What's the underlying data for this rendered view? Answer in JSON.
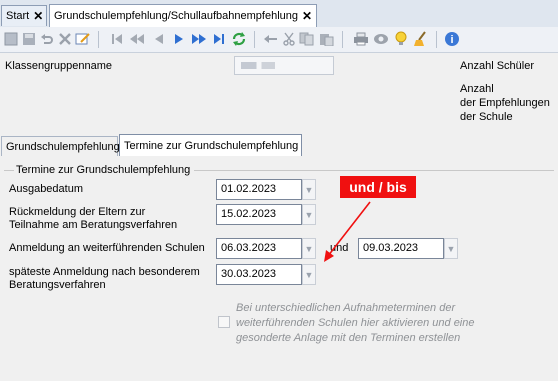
{
  "doc_tabs": [
    {
      "label": "Start",
      "close": "✕"
    },
    {
      "label": "Grundschulempfehlung/Schullaufbahnempfehlung",
      "close": "✕"
    }
  ],
  "toolbar": {
    "icons": [
      "new-icon",
      "save-icon",
      "undo-icon",
      "delete-icon",
      "edit-icon",
      "first-icon",
      "previous-page-icon",
      "previous-icon",
      "next-icon",
      "next-page-icon",
      "last-icon",
      "refresh-icon",
      "back-icon",
      "cut-icon",
      "copy-icon",
      "paste-icon",
      "print-icon",
      "preview-icon",
      "idea-icon",
      "clear-icon",
      "help-icon"
    ]
  },
  "header": {
    "group_name_label": "Klassengruppenname",
    "count_students_label": "Anzahl Schüler",
    "count_recommendations_label": "Anzahl\nder Empfehlungen\nder Schule"
  },
  "tabs": [
    {
      "label": "Grundschulempfehlung"
    },
    {
      "label": "Termine zur Grundschulempfehlung"
    }
  ],
  "group": {
    "title": "Termine zur Grundschulempfehlung",
    "fields": [
      {
        "label": "Ausgabedatum",
        "value": "01.02.2023"
      },
      {
        "label": "Rückmeldung der Eltern zur\nTeilnahme am Beratungsverfahren",
        "value": "15.02.2023"
      },
      {
        "label": "Anmeldung an weiterführenden Schulen",
        "value": "06.03.2023",
        "connector": "und",
        "value2": "09.03.2023"
      },
      {
        "label": "späteste Anmeldung nach besonderem\nBeratungsverfahren",
        "value": "30.03.2023"
      }
    ],
    "checkbox_text": "Bei unterschiedlichen Aufnahmeterminen der weiterführenden Schulen hier aktivieren und eine gesonderte Anlage mit den Terminen erstellen"
  },
  "annotation": {
    "text": "und / bis",
    "color": "#f01010"
  }
}
